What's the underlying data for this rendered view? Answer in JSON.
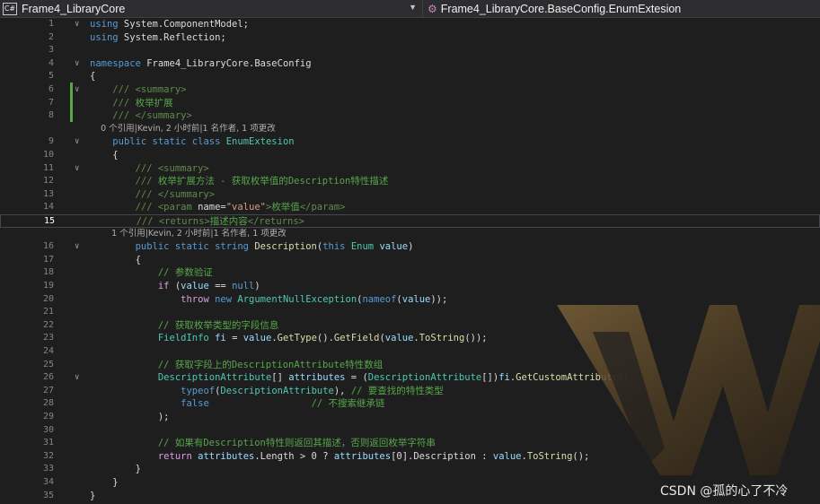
{
  "navbar": {
    "project_icon": "C#",
    "project": "Frame4_LibraryCore",
    "member": "Frame4_LibraryCore.BaseConfig.EnumExtesion"
  },
  "editor": {
    "active_line": 15,
    "code_lens_1": "0 个引用|Kevin, 2 小时前|1 名作者, 1 项更改",
    "code_lens_2": "1 个引用|Kevin, 2 小时前|1 名作者, 1 项更改",
    "lines": [
      {
        "n": "1",
        "fold": "∨",
        "t": [
          [
            "kw",
            "using"
          ],
          [
            "pl",
            " System.ComponentModel;"
          ]
        ]
      },
      {
        "n": "2",
        "t": [
          [
            "kw",
            "using"
          ],
          [
            "pl",
            " System.Reflection;"
          ]
        ]
      },
      {
        "n": "3",
        "t": []
      },
      {
        "n": "4",
        "fold": "∨",
        "t": [
          [
            "kw",
            "namespace"
          ],
          [
            "pl",
            " Frame4_LibraryCore.BaseConfig"
          ]
        ]
      },
      {
        "n": "5",
        "t": [
          [
            "pl",
            "{"
          ]
        ]
      },
      {
        "n": "6",
        "fold": "∨",
        "t": [
          [
            "xml",
            "    /// <summary>"
          ]
        ]
      },
      {
        "n": "7",
        "t": [
          [
            "xml",
            "    /// "
          ],
          [
            "cm",
            "枚举扩展"
          ]
        ]
      },
      {
        "n": "8",
        "t": [
          [
            "xml",
            "    /// </summary>"
          ]
        ]
      },
      {
        "lens": "code_lens_1",
        "indent": "    "
      },
      {
        "n": "9",
        "fold": "∨",
        "t": [
          [
            "pl",
            "    "
          ],
          [
            "kw",
            "public static class"
          ],
          [
            "pl",
            " "
          ],
          [
            "ty",
            "EnumExtesion"
          ]
        ]
      },
      {
        "n": "10",
        "t": [
          [
            "pl",
            "    {"
          ]
        ]
      },
      {
        "n": "11",
        "fold": "∨",
        "t": [
          [
            "xml",
            "        /// <summary>"
          ]
        ]
      },
      {
        "n": "12",
        "t": [
          [
            "xml",
            "        /// "
          ],
          [
            "cm",
            "枚举扩展方法 - 获取枚举值的Description特性描述"
          ]
        ]
      },
      {
        "n": "13",
        "t": [
          [
            "xml",
            "        /// </summary>"
          ]
        ]
      },
      {
        "n": "14",
        "t": [
          [
            "xml",
            "        /// <param "
          ],
          [
            "pl",
            "name="
          ],
          [
            "str",
            "\"value\""
          ],
          [
            "xml",
            ">"
          ],
          [
            "cm",
            "枚举值"
          ],
          [
            "xml",
            "</param>"
          ]
        ]
      },
      {
        "n": "15",
        "t": [
          [
            "xml",
            "        /// <returns>"
          ],
          [
            "cm",
            "描述内容"
          ],
          [
            "xml",
            "</returns>"
          ]
        ]
      },
      {
        "lens": "code_lens_2",
        "indent": "        "
      },
      {
        "n": "16",
        "fold": "∨",
        "t": [
          [
            "pl",
            "        "
          ],
          [
            "kw",
            "public static string"
          ],
          [
            "pl",
            " "
          ],
          [
            "mth",
            "Description"
          ],
          [
            "pl",
            "("
          ],
          [
            "kw",
            "this"
          ],
          [
            "pl",
            " "
          ],
          [
            "ty",
            "Enum"
          ],
          [
            "pl",
            " "
          ],
          [
            "prm",
            "value"
          ],
          [
            "pl",
            ")"
          ]
        ]
      },
      {
        "n": "17",
        "t": [
          [
            "pl",
            "        {"
          ]
        ]
      },
      {
        "n": "18",
        "t": [
          [
            "cm",
            "            // 参数验证"
          ]
        ]
      },
      {
        "n": "19",
        "t": [
          [
            "pl",
            "            "
          ],
          [
            "ctl",
            "if"
          ],
          [
            "pl",
            " ("
          ],
          [
            "prm",
            "value"
          ],
          [
            "pl",
            " == "
          ],
          [
            "kw",
            "null"
          ],
          [
            "pl",
            ")"
          ]
        ]
      },
      {
        "n": "20",
        "t": [
          [
            "pl",
            "                "
          ],
          [
            "ctl",
            "throw"
          ],
          [
            "pl",
            " "
          ],
          [
            "kw",
            "new"
          ],
          [
            "pl",
            " "
          ],
          [
            "ty",
            "ArgumentNullException"
          ],
          [
            "pl",
            "("
          ],
          [
            "kw",
            "nameof"
          ],
          [
            "pl",
            "("
          ],
          [
            "prm",
            "value"
          ],
          [
            "pl",
            "));"
          ]
        ]
      },
      {
        "n": "21",
        "t": []
      },
      {
        "n": "22",
        "t": [
          [
            "cm",
            "            // 获取枚举类型的字段信息"
          ]
        ]
      },
      {
        "n": "23",
        "t": [
          [
            "pl",
            "            "
          ],
          [
            "ty",
            "FieldInfo"
          ],
          [
            "pl",
            " "
          ],
          [
            "prm",
            "fi"
          ],
          [
            "pl",
            " = "
          ],
          [
            "prm",
            "value"
          ],
          [
            "pl",
            "."
          ],
          [
            "mth",
            "GetType"
          ],
          [
            "pl",
            "()."
          ],
          [
            "mth",
            "GetField"
          ],
          [
            "pl",
            "("
          ],
          [
            "prm",
            "value"
          ],
          [
            "pl",
            "."
          ],
          [
            "mth",
            "ToString"
          ],
          [
            "pl",
            "());"
          ]
        ]
      },
      {
        "n": "24",
        "t": []
      },
      {
        "n": "25",
        "t": [
          [
            "cm",
            "            // 获取字段上的DescriptionAttribute特性数组"
          ]
        ]
      },
      {
        "n": "26",
        "fold": "∨",
        "t": [
          [
            "pl",
            "            "
          ],
          [
            "ty",
            "DescriptionAttribute"
          ],
          [
            "pl",
            "[] "
          ],
          [
            "prm",
            "attributes"
          ],
          [
            "pl",
            " = ("
          ],
          [
            "ty",
            "DescriptionAttribute"
          ],
          [
            "pl",
            "[])"
          ],
          [
            "prm",
            "fi"
          ],
          [
            "pl",
            "."
          ],
          [
            "mth",
            "GetCustomAttributes"
          ],
          [
            "pl",
            "("
          ]
        ]
      },
      {
        "n": "27",
        "t": [
          [
            "pl",
            "                "
          ],
          [
            "kw",
            "typeof"
          ],
          [
            "pl",
            "("
          ],
          [
            "ty",
            "DescriptionAttribute"
          ],
          [
            "pl",
            "), "
          ],
          [
            "cm",
            "// 要查找的特性类型"
          ]
        ]
      },
      {
        "n": "28",
        "t": [
          [
            "pl",
            "                "
          ],
          [
            "kw",
            "false"
          ],
          [
            "pl",
            "                  "
          ],
          [
            "cm",
            "// 不搜索继承链"
          ]
        ]
      },
      {
        "n": "29",
        "t": [
          [
            "pl",
            "            );"
          ]
        ]
      },
      {
        "n": "30",
        "t": []
      },
      {
        "n": "31",
        "t": [
          [
            "cm",
            "            // 如果有Description特性则返回其描述，否则返回枚举字符串"
          ]
        ]
      },
      {
        "n": "32",
        "t": [
          [
            "pl",
            "            "
          ],
          [
            "ctl",
            "return"
          ],
          [
            "pl",
            " "
          ],
          [
            "prm",
            "attributes"
          ],
          [
            "pl",
            ".Length > 0 ? "
          ],
          [
            "prm",
            "attributes"
          ],
          [
            "pl",
            "[0].Description : "
          ],
          [
            "prm",
            "value"
          ],
          [
            "pl",
            "."
          ],
          [
            "mth",
            "ToString"
          ],
          [
            "pl",
            "();"
          ]
        ]
      },
      {
        "n": "33",
        "t": [
          [
            "pl",
            "        }"
          ]
        ]
      },
      {
        "n": "34",
        "t": [
          [
            "pl",
            "    }"
          ]
        ]
      },
      {
        "n": "35",
        "t": [
          [
            "pl",
            "}"
          ]
        ]
      }
    ]
  },
  "watermark": "CSDN @孤的心了不冷",
  "colors": {
    "background": "#1e1e1e",
    "keyword": "#569cd6",
    "control": "#d8a0df",
    "type": "#4ec9b0",
    "comment": "#57a64a",
    "string": "#d69d85",
    "method": "#dcdcaa",
    "param": "#9cdcfe"
  }
}
